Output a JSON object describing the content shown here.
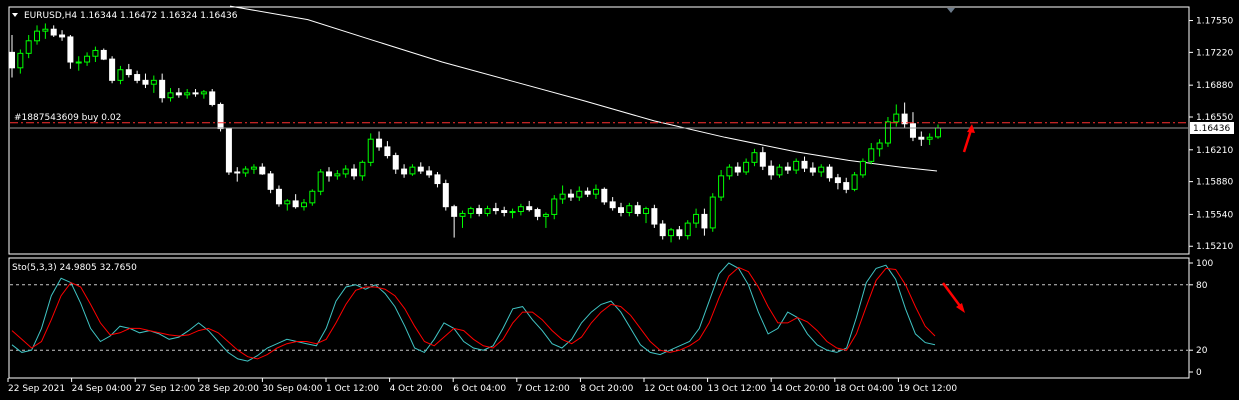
{
  "header": {
    "symbol_line": "EURUSD,H4  1.16344 1.16472 1.16324 1.16436",
    "menu_icon": "triangle-down-icon"
  },
  "order_line": {
    "label_main": "#1887543609",
    "label_suffix": "buy 0.02",
    "price": 1.1649
  },
  "current_price_label": "1.16436",
  "colors": {
    "background": "#000000",
    "grid": "#ffffff",
    "bull": "#00ff00",
    "bear": "#ffffff",
    "ma": "#ffffff",
    "main_line": "#40c4c4",
    "signal_line": "#ff0000",
    "order_line": "#ff3030",
    "arrow": "#ff0000"
  },
  "chart_data": [
    {
      "type": "candlestick",
      "name": "EURUSD,H4",
      "ylim": [
        1.1514,
        1.1768
      ],
      "y_ticks": [
        "1.17550",
        "1.17220",
        "1.16880",
        "1.16550",
        "1.16436",
        "1.16210",
        "1.15880",
        "1.15540",
        "1.15210"
      ],
      "y_tick_values": [
        1.1755,
        1.1722,
        1.1688,
        1.1655,
        1.16436,
        1.1621,
        1.1588,
        1.1554,
        1.1521
      ],
      "x_labels": [
        "22 Sep 2021",
        "24 Sep 04:00",
        "27 Sep 12:00",
        "28 Sep 20:00",
        "30 Sep 04:00",
        "1 Oct 12:00",
        "4 Oct 20:00",
        "6 Oct 04:00",
        "7 Oct 12:00",
        "8 Oct 20:00",
        "12 Oct 04:00",
        "13 Oct 12:00",
        "14 Oct 20:00",
        "18 Oct 04:00",
        "19 Oct 12:00"
      ],
      "candles_ohlc": [
        [
          1.1722,
          1.174,
          1.1696,
          1.1706
        ],
        [
          1.1706,
          1.1725,
          1.17,
          1.1721
        ],
        [
          1.1721,
          1.174,
          1.1716,
          1.1734
        ],
        [
          1.1734,
          1.175,
          1.173,
          1.1744
        ],
        [
          1.1744,
          1.1752,
          1.1736,
          1.1746
        ],
        [
          1.1746,
          1.175,
          1.1738,
          1.174
        ],
        [
          1.174,
          1.1745,
          1.1734,
          1.1738
        ],
        [
          1.1738,
          1.174,
          1.1705,
          1.1712
        ],
        [
          1.1712,
          1.1718,
          1.1703,
          1.1712
        ],
        [
          1.1712,
          1.1722,
          1.1708,
          1.1718
        ],
        [
          1.1718,
          1.1728,
          1.1712,
          1.1724
        ],
        [
          1.1724,
          1.1726,
          1.1714,
          1.1715
        ],
        [
          1.1715,
          1.1718,
          1.169,
          1.1693
        ],
        [
          1.1693,
          1.1708,
          1.1689,
          1.1704
        ],
        [
          1.1704,
          1.171,
          1.1696,
          1.1699
        ],
        [
          1.1699,
          1.1703,
          1.169,
          1.1693
        ],
        [
          1.1693,
          1.17,
          1.1685,
          1.1689
        ],
        [
          1.1689,
          1.1698,
          1.168,
          1.1693
        ],
        [
          1.1693,
          1.17,
          1.167,
          1.1675
        ],
        [
          1.1675,
          1.1685,
          1.1671,
          1.168
        ],
        [
          1.168,
          1.1685,
          1.1675,
          1.1678
        ],
        [
          1.1678,
          1.1684,
          1.1674,
          1.168
        ],
        [
          1.168,
          1.1684,
          1.1676,
          1.1679
        ],
        [
          1.1679,
          1.1683,
          1.1674,
          1.1681
        ],
        [
          1.1681,
          1.1684,
          1.1666,
          1.1668
        ],
        [
          1.1668,
          1.167,
          1.164,
          1.1643
        ],
        [
          1.1643,
          1.1644,
          1.1595,
          1.1598
        ],
        [
          1.1598,
          1.1603,
          1.1588,
          1.1597
        ],
        [
          1.1597,
          1.1604,
          1.1593,
          1.1601
        ],
        [
          1.1601,
          1.1606,
          1.1596,
          1.1603
        ],
        [
          1.1603,
          1.1607,
          1.1595,
          1.1596
        ],
        [
          1.1596,
          1.1599,
          1.1576,
          1.158
        ],
        [
          1.158,
          1.1584,
          1.1562,
          1.1565
        ],
        [
          1.1565,
          1.157,
          1.1558,
          1.1568
        ],
        [
          1.1568,
          1.1575,
          1.156,
          1.1562
        ],
        [
          1.1562,
          1.157,
          1.1558,
          1.1566
        ],
        [
          1.1566,
          1.158,
          1.1563,
          1.1578
        ],
        [
          1.1578,
          1.1601,
          1.1574,
          1.1598
        ],
        [
          1.1598,
          1.1603,
          1.1588,
          1.1594
        ],
        [
          1.1594,
          1.16,
          1.159,
          1.1596
        ],
        [
          1.1596,
          1.1605,
          1.1592,
          1.1601
        ],
        [
          1.1601,
          1.1606,
          1.159,
          1.1594
        ],
        [
          1.1594,
          1.161,
          1.1589,
          1.1608
        ],
        [
          1.1608,
          1.1638,
          1.1604,
          1.1632
        ],
        [
          1.1632,
          1.164,
          1.162,
          1.1624
        ],
        [
          1.1624,
          1.163,
          1.1612,
          1.1615
        ],
        [
          1.1615,
          1.1618,
          1.1596,
          1.1601
        ],
        [
          1.1601,
          1.1606,
          1.1592,
          1.1596
        ],
        [
          1.1596,
          1.1606,
          1.1594,
          1.1603
        ],
        [
          1.1603,
          1.1608,
          1.1596,
          1.1599
        ],
        [
          1.1599,
          1.1604,
          1.1592,
          1.1595
        ],
        [
          1.1595,
          1.1598,
          1.1582,
          1.1586
        ],
        [
          1.1586,
          1.159,
          1.1558,
          1.1562
        ],
        [
          1.1562,
          1.1564,
          1.153,
          1.1552
        ],
        [
          1.1552,
          1.1558,
          1.154,
          1.1555
        ],
        [
          1.1555,
          1.1562,
          1.155,
          1.156
        ],
        [
          1.156,
          1.1564,
          1.1552,
          1.1555
        ],
        [
          1.1555,
          1.1563,
          1.1552,
          1.156
        ],
        [
          1.156,
          1.1566,
          1.1554,
          1.1558
        ],
        [
          1.1558,
          1.1562,
          1.1552,
          1.1556
        ],
        [
          1.1556,
          1.156,
          1.155,
          1.1557
        ],
        [
          1.1557,
          1.1565,
          1.1553,
          1.1562
        ],
        [
          1.1562,
          1.1568,
          1.1557,
          1.1559
        ],
        [
          1.1559,
          1.1561,
          1.1548,
          1.1552
        ],
        [
          1.1552,
          1.1556,
          1.154,
          1.1554
        ],
        [
          1.1554,
          1.1574,
          1.1549,
          1.157
        ],
        [
          1.157,
          1.1584,
          1.1565,
          1.1575
        ],
        [
          1.1575,
          1.158,
          1.1568,
          1.1572
        ],
        [
          1.1572,
          1.1583,
          1.1568,
          1.1578
        ],
        [
          1.1578,
          1.1582,
          1.1572,
          1.1575
        ],
        [
          1.1575,
          1.1585,
          1.157,
          1.158
        ],
        [
          1.158,
          1.1582,
          1.1564,
          1.1567
        ],
        [
          1.1567,
          1.1572,
          1.1558,
          1.1561
        ],
        [
          1.1561,
          1.1566,
          1.1552,
          1.1556
        ],
        [
          1.1556,
          1.1566,
          1.1552,
          1.1563
        ],
        [
          1.1563,
          1.1567,
          1.1552,
          1.1555
        ],
        [
          1.1555,
          1.1562,
          1.1545,
          1.156
        ],
        [
          1.156,
          1.1564,
          1.154,
          1.1544
        ],
        [
          1.1544,
          1.1548,
          1.1528,
          1.1532
        ],
        [
          1.1532,
          1.154,
          1.1525,
          1.1538
        ],
        [
          1.1538,
          1.1542,
          1.1528,
          1.1532
        ],
        [
          1.1532,
          1.1548,
          1.1528,
          1.1545
        ],
        [
          1.1545,
          1.156,
          1.154,
          1.1554
        ],
        [
          1.1554,
          1.156,
          1.1532,
          1.154
        ],
        [
          1.154,
          1.1576,
          1.1536,
          1.1572
        ],
        [
          1.1572,
          1.16,
          1.1568,
          1.1594
        ],
        [
          1.1594,
          1.1606,
          1.159,
          1.1603
        ],
        [
          1.1603,
          1.1608,
          1.1594,
          1.1598
        ],
        [
          1.1598,
          1.1612,
          1.1595,
          1.1608
        ],
        [
          1.1608,
          1.1622,
          1.1604,
          1.1618
        ],
        [
          1.1618,
          1.1624,
          1.16,
          1.1604
        ],
        [
          1.1604,
          1.161,
          1.159,
          1.1595
        ],
        [
          1.1595,
          1.1606,
          1.1592,
          1.1603
        ],
        [
          1.1603,
          1.1608,
          1.1596,
          1.16
        ],
        [
          1.16,
          1.1612,
          1.1596,
          1.1609
        ],
        [
          1.1609,
          1.1614,
          1.1598,
          1.1602
        ],
        [
          1.1602,
          1.1608,
          1.1594,
          1.1598
        ],
        [
          1.1598,
          1.1606,
          1.1593,
          1.1603
        ],
        [
          1.1603,
          1.1606,
          1.1588,
          1.1592
        ],
        [
          1.1592,
          1.1596,
          1.158,
          1.1587
        ],
        [
          1.1587,
          1.1592,
          1.1576,
          1.158
        ],
        [
          1.158,
          1.1598,
          1.1578,
          1.1595
        ],
        [
          1.1595,
          1.1612,
          1.1592,
          1.1609
        ],
        [
          1.1609,
          1.1628,
          1.1606,
          1.1622
        ],
        [
          1.1622,
          1.1632,
          1.1614,
          1.1628
        ],
        [
          1.1628,
          1.1655,
          1.1624,
          1.165
        ],
        [
          1.165,
          1.1668,
          1.1645,
          1.1658
        ],
        [
          1.1658,
          1.167,
          1.1644,
          1.1648
        ],
        [
          1.1648,
          1.166,
          1.163,
          1.1634
        ],
        [
          1.1634,
          1.164,
          1.1625,
          1.1632
        ],
        [
          1.1632,
          1.1638,
          1.1626,
          1.1634
        ],
        [
          1.16344,
          1.16472,
          1.16324,
          1.16436
        ]
      ],
      "moving_average": [
        [
          0,
          1.177
        ],
        [
          22,
          1.1756
        ],
        [
          40,
          1.1735
        ],
        [
          60,
          1.1712
        ],
        [
          80,
          1.1692
        ],
        [
          100,
          1.1672
        ],
        [
          120,
          1.1651
        ],
        [
          140,
          1.1634
        ],
        [
          160,
          1.1619
        ],
        [
          175,
          1.161
        ],
        [
          190,
          1.1603
        ],
        [
          200,
          1.1599
        ]
      ]
    },
    {
      "type": "line",
      "name": "Sto(5,3,3) 24.9805 32.7650",
      "ylim": [
        0,
        100
      ],
      "y_ticks": [
        "100",
        "80",
        "20",
        "0"
      ],
      "y_tick_values": [
        100,
        80,
        20,
        0
      ],
      "levels": [
        80,
        20
      ],
      "series": [
        {
          "name": "main",
          "values": [
            25,
            18,
            20,
            40,
            70,
            86,
            82,
            63,
            40,
            28,
            33,
            42,
            40,
            36,
            38,
            35,
            30,
            32,
            38,
            45,
            38,
            28,
            18,
            12,
            10,
            15,
            22,
            26,
            30,
            28,
            26,
            24,
            40,
            65,
            78,
            80,
            76,
            80,
            72,
            60,
            42,
            22,
            18,
            30,
            45,
            40,
            28,
            22,
            20,
            24,
            40,
            58,
            60,
            48,
            38,
            26,
            22,
            30,
            45,
            55,
            62,
            65,
            55,
            40,
            25,
            18,
            16,
            20,
            24,
            28,
            40,
            65,
            90,
            100,
            95,
            80,
            55,
            35,
            40,
            55,
            50,
            35,
            25,
            20,
            18,
            22,
            50,
            82,
            95,
            98,
            85,
            58,
            35,
            27,
            25
          ]
        },
        {
          "name": "signal",
          "values": [
            38,
            30,
            22,
            28,
            48,
            70,
            82,
            78,
            62,
            45,
            34,
            36,
            40,
            40,
            38,
            36,
            34,
            33,
            34,
            38,
            40,
            36,
            28,
            20,
            14,
            12,
            16,
            22,
            26,
            28,
            28,
            26,
            30,
            45,
            62,
            75,
            78,
            78,
            76,
            70,
            58,
            42,
            28,
            24,
            32,
            40,
            38,
            30,
            24,
            22,
            30,
            45,
            55,
            55,
            48,
            38,
            30,
            26,
            32,
            45,
            55,
            62,
            60,
            52,
            40,
            28,
            20,
            18,
            20,
            24,
            30,
            45,
            68,
            88,
            96,
            92,
            78,
            60,
            45,
            45,
            50,
            46,
            38,
            28,
            22,
            20,
            35,
            60,
            84,
            95,
            94,
            80,
            60,
            42,
            33
          ]
        }
      ],
      "arrow_direction": "down"
    }
  ]
}
